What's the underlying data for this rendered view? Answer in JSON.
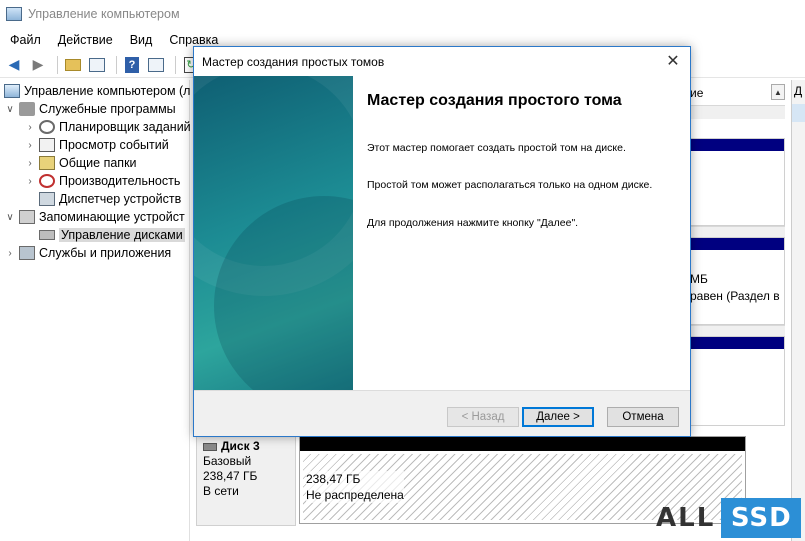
{
  "window": {
    "title": "Управление компьютером"
  },
  "menu": [
    "Файл",
    "Действие",
    "Вид",
    "Справка"
  ],
  "tree": {
    "root": "Управление компьютером (л",
    "system_tools": "Служебные программы",
    "task_scheduler": "Планировщик заданий",
    "event_viewer": "Просмотр событий",
    "shared_folders": "Общие папки",
    "performance": "Производительность",
    "device_manager": "Диспетчер устройств",
    "storage": "Запоминающие устройст",
    "disk_management": "Управление дисками",
    "services": "Службы и приложения"
  },
  "background": {
    "column_header": "ие",
    "actions_header": "Д",
    "size_fragment": "МБ",
    "status_fragment": "равен (Раздел в"
  },
  "disk": {
    "name": "Диск 3",
    "type": "Базовый",
    "size": "238,47 ГБ",
    "status": "В сети",
    "partition_size": "238,47 ГБ",
    "partition_status": "Не распределена"
  },
  "wizard": {
    "title": "Мастер создания простых томов",
    "heading": "Мастер создания простого тома",
    "p1": "Этот мастер помогает создать простой том на диске.",
    "p2": "Простой том может располагаться только на одном диске.",
    "p3": "Для продолжения нажмите кнопку \"Далее\".",
    "back": "< Назад",
    "next": "Далее >",
    "cancel": "Отмена"
  },
  "logo": {
    "part1": "ALL",
    "part2": "SSD"
  },
  "colors": {
    "accent": "#0078d7",
    "volume_bar": "#000080",
    "wizard_side": "#1c8b93"
  }
}
